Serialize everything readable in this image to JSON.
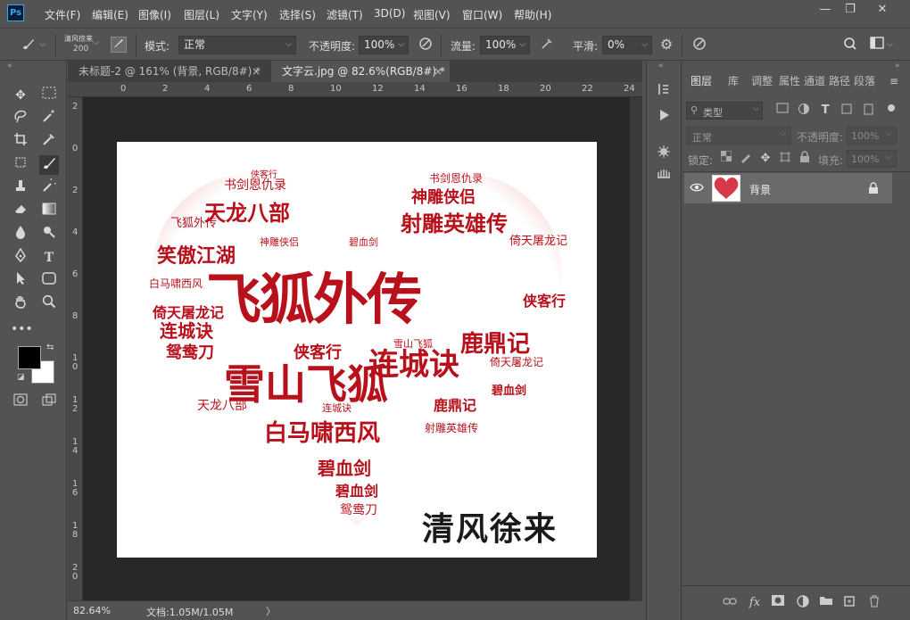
{
  "app": {
    "logo": "Ps"
  },
  "menu": [
    "文件(F)",
    "编辑(E)",
    "图像(I)",
    "图层(L)",
    "文字(Y)",
    "选择(S)",
    "滤镜(T)",
    "3D(D)",
    "视图(V)",
    "窗口(W)",
    "帮助(H)"
  ],
  "window_controls": {
    "minimize": "—",
    "restore": "❐",
    "close": "✕"
  },
  "options": {
    "brush_name": "清风徐来",
    "brush_size": "200",
    "mode_label": "模式:",
    "mode_value": "正常",
    "opacity_label": "不透明度:",
    "opacity_value": "100%",
    "flow_label": "流量:",
    "flow_value": "100%",
    "smooth_label": "平滑:",
    "smooth_value": "0%"
  },
  "tabs": [
    {
      "label": "未标题-2 @ 161% (背景, RGB/8#) *",
      "close": "×"
    },
    {
      "label": "文字云.jpg @ 82.6%(RGB/8#) *",
      "close": "×"
    }
  ],
  "ruler_top": [
    "0",
    "2",
    "4",
    "6",
    "8",
    "10",
    "12",
    "14",
    "16",
    "18",
    "20",
    "22",
    "24"
  ],
  "ruler_left": [
    "2",
    "0",
    "2",
    "4",
    "6",
    "8",
    "1\n0",
    "1\n2",
    "1\n4",
    "1\n6",
    "1\n8",
    "2\n0"
  ],
  "document": {
    "watermark": "清风徐来",
    "words": [
      {
        "t": "飞狐外传",
        "s": 62
      },
      {
        "t": "雪山飞狐",
        "s": 46
      },
      {
        "t": "射雕英雄传",
        "s": 26
      },
      {
        "t": "连城诀",
        "s": 34
      },
      {
        "t": "天龙八部",
        "s": 28
      },
      {
        "t": "笑傲江湖",
        "s": 22
      },
      {
        "t": "白马啸西风",
        "s": 26
      },
      {
        "t": "鹿鼎记",
        "s": 28
      },
      {
        "t": "神雕侠侣",
        "s": 20
      },
      {
        "t": "书剑恩仇录",
        "s": 16
      },
      {
        "t": "侠客行",
        "s": 20
      },
      {
        "t": "倚天屠龙记",
        "s": 16
      },
      {
        "t": "碧血剑",
        "s": 20
      },
      {
        "t": "鸳鸯刀",
        "s": 20
      },
      {
        "t": "连城诀",
        "s": 20
      },
      {
        "t": "飞狐外传",
        "s": 14
      },
      {
        "t": "侠客行",
        "s": 16
      },
      {
        "t": "碧血剑",
        "s": 16
      }
    ]
  },
  "status": {
    "zoom": "82.64%",
    "doc": "文档:1.05M/1.05M",
    "arrow": "〉"
  },
  "layers_panel": {
    "tabs": [
      "图层",
      "库",
      "调整",
      "属性",
      "通道",
      "路径",
      "段落"
    ],
    "filter_kind": "类型",
    "blend_mode": "正常",
    "opacity_label": "不透明度:",
    "opacity_value": "100%",
    "lock_label": "锁定:",
    "fill_label": "填充:",
    "fill_value": "100%",
    "layer_name": "背景"
  },
  "colors": {
    "accent": "#31a8ff",
    "word_red": "#b8111c",
    "panel": "#535353",
    "canvas": "#282828"
  }
}
